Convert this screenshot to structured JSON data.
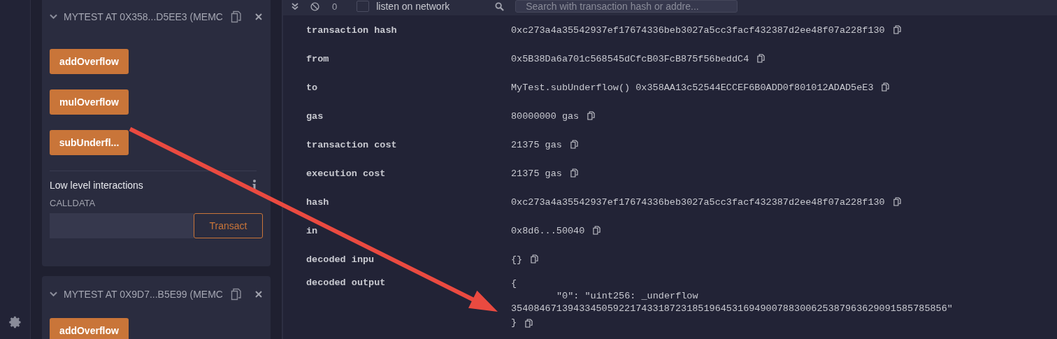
{
  "sidebar": {
    "instances": [
      {
        "title": "MYTEST AT 0X358...D5EE3 (MEMC",
        "expanded": true,
        "functions": [
          "addOverflow",
          "mulOverflow",
          "subUnderfl..."
        ],
        "low_level": {
          "title": "Low level interactions",
          "calldata_label": "CALLDATA",
          "button": "Transact"
        }
      },
      {
        "title": "MYTEST AT 0X9D7...B5E99 (MEMC",
        "expanded": true,
        "functions": [
          "addOverflow"
        ]
      }
    ]
  },
  "toolbar": {
    "count": "0",
    "listen": {
      "label": "listen on network",
      "checked": false
    },
    "search": {
      "placeholder": "Search with transaction hash or addre..."
    }
  },
  "transaction": {
    "rows": [
      {
        "label": "transaction hash",
        "kind": "text",
        "value": "0xc273a4a35542937ef17674336beb3027a5cc3facf432387d2ee48f07a228f130"
      },
      {
        "label": "from",
        "kind": "text",
        "value": "0x5B38Da6a701c568545dCfcB03FcB875f56beddC4"
      },
      {
        "label": "to",
        "kind": "text",
        "value": "MyTest.subUnderflow() 0x358AA13c52544ECCEF6B0ADD0f801012ADAD5eE3"
      },
      {
        "label": "gas",
        "kind": "text",
        "value": "80000000 gas"
      },
      {
        "label": "transaction cost",
        "kind": "text",
        "value": "21375 gas"
      },
      {
        "label": "execution cost",
        "kind": "text",
        "value": "21375 gas"
      },
      {
        "label": "hash",
        "kind": "text",
        "value": "0xc273a4a35542937ef17674336beb3027a5cc3facf432387d2ee48f07a228f130"
      },
      {
        "label": "in",
        "kind": "text",
        "value": "0x8d6...50040"
      },
      {
        "label": "decoded inpu",
        "kind": "text",
        "value": "{}"
      },
      {
        "label": "decoded output",
        "kind": "lines",
        "lines": [
          "{",
          "\"0\": \"uint256: _underflow",
          "35408467139433450592217433187231851964531694900788300625387963629091585785856\"",
          "}"
        ]
      }
    ]
  },
  "annotation": {
    "kind": "arrow"
  }
}
